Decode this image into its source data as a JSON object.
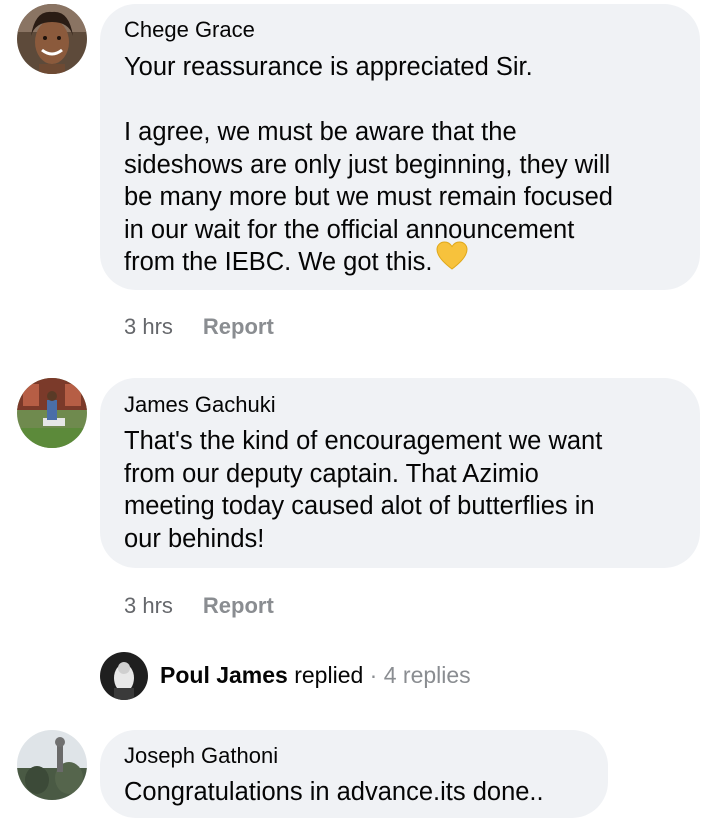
{
  "comments": [
    {
      "author": "Chege Grace",
      "lines_para1": [
        "Your reassurance is appreciated Sir."
      ],
      "lines_para2": [
        "I agree, we must be aware that the",
        "sideshows are only just beginning, they will",
        "be many more but we must remain focused",
        "in our wait for the official announcement",
        "from the IEBC. We got this."
      ],
      "emoji": "yellow-heart-icon",
      "time": "3 hrs",
      "report_label": "Report"
    },
    {
      "author": "James Gachuki",
      "lines": [
        "That's the kind of encouragement we want",
        "from our deputy captain. That Azimio",
        "meeting today caused alot of butterflies in",
        "our behinds!"
      ],
      "time": "3 hrs",
      "report_label": "Report"
    },
    {
      "author": "Joseph Gathoni",
      "lines": [
        "Congratulations in advance.its done.."
      ]
    }
  ],
  "reply_summary": {
    "name": "Poul James",
    "verb": "replied",
    "separator": "·",
    "count": "4 replies"
  },
  "colors": {
    "bubble": "#f0f2f5",
    "meta_text": "#65676b",
    "heart": "#f7c23c"
  }
}
